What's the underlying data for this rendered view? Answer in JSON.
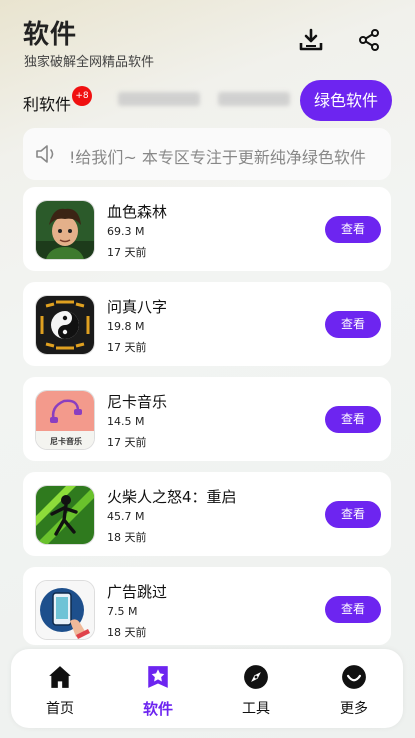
{
  "header": {
    "title": "软件",
    "subtitle": "独家破解全网精品软件",
    "download_icon": "download-icon",
    "share_icon": "share-icon"
  },
  "tabs": {
    "current_label": "利软件",
    "badge": "+8",
    "active_button": "绿色软件"
  },
  "notice": {
    "icon": "speaker-icon",
    "text": "!给我们~   本专区专注于更新纯净绿色软件"
  },
  "apps": [
    {
      "name": "血色森林",
      "size": "69.3 M",
      "time": "17 天前",
      "button": "查看"
    },
    {
      "name": "问真八字",
      "size": "19.8 M",
      "time": "17 天前",
      "button": "查看"
    },
    {
      "name": "尼卡音乐",
      "size": "14.5 M",
      "time": "17 天前",
      "button": "查看",
      "icon_caption": "尼卡音乐"
    },
    {
      "name": "火柴人之怒4：重启",
      "size": "45.7 M",
      "time": "18 天前",
      "button": "查看"
    },
    {
      "name": "广告跳过",
      "size": "7.5 M",
      "time": "18 天前",
      "button": "查看"
    }
  ],
  "nav": [
    {
      "label": "首页",
      "icon": "home-icon"
    },
    {
      "label": "软件",
      "icon": "software-star-icon",
      "active": true
    },
    {
      "label": "工具",
      "icon": "compass-icon"
    },
    {
      "label": "更多",
      "icon": "more-smile-icon"
    }
  ],
  "colors": {
    "accent": "#6d25f0",
    "badge": "#f01010"
  }
}
